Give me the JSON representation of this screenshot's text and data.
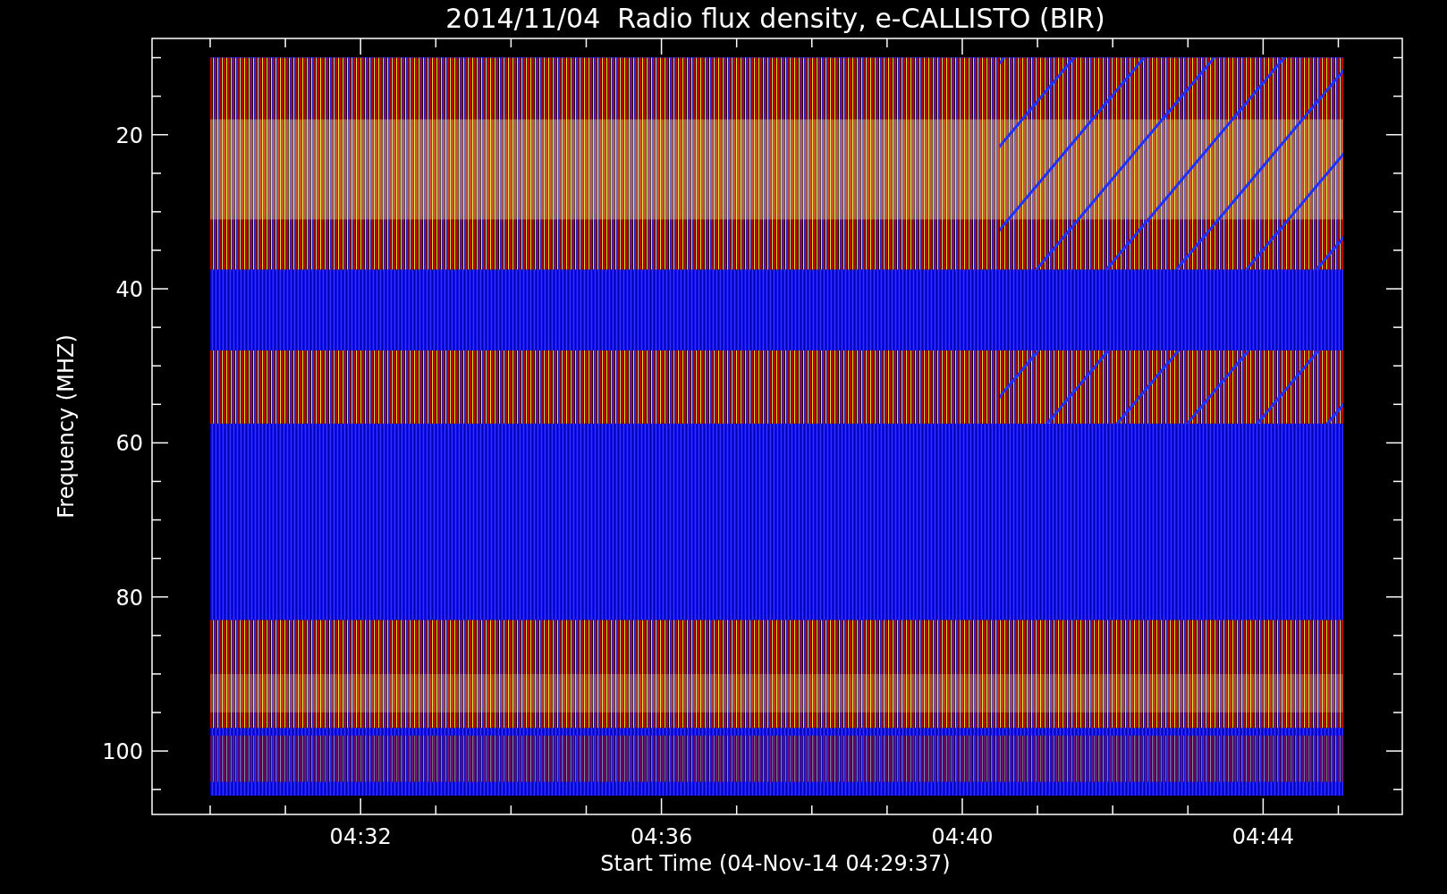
{
  "title": "2014/11/04  Radio flux density, e-CALLISTO (BIR)",
  "y_axis": {
    "label": "Frequency (MHZ)",
    "ticks": [
      "20",
      "40",
      "60",
      "80",
      "100"
    ]
  },
  "x_axis": {
    "label": "Start Time (04-Nov-14 04:29:37)",
    "ticks": [
      "04:32",
      "04:36",
      "04:40",
      "04:44"
    ]
  }
}
